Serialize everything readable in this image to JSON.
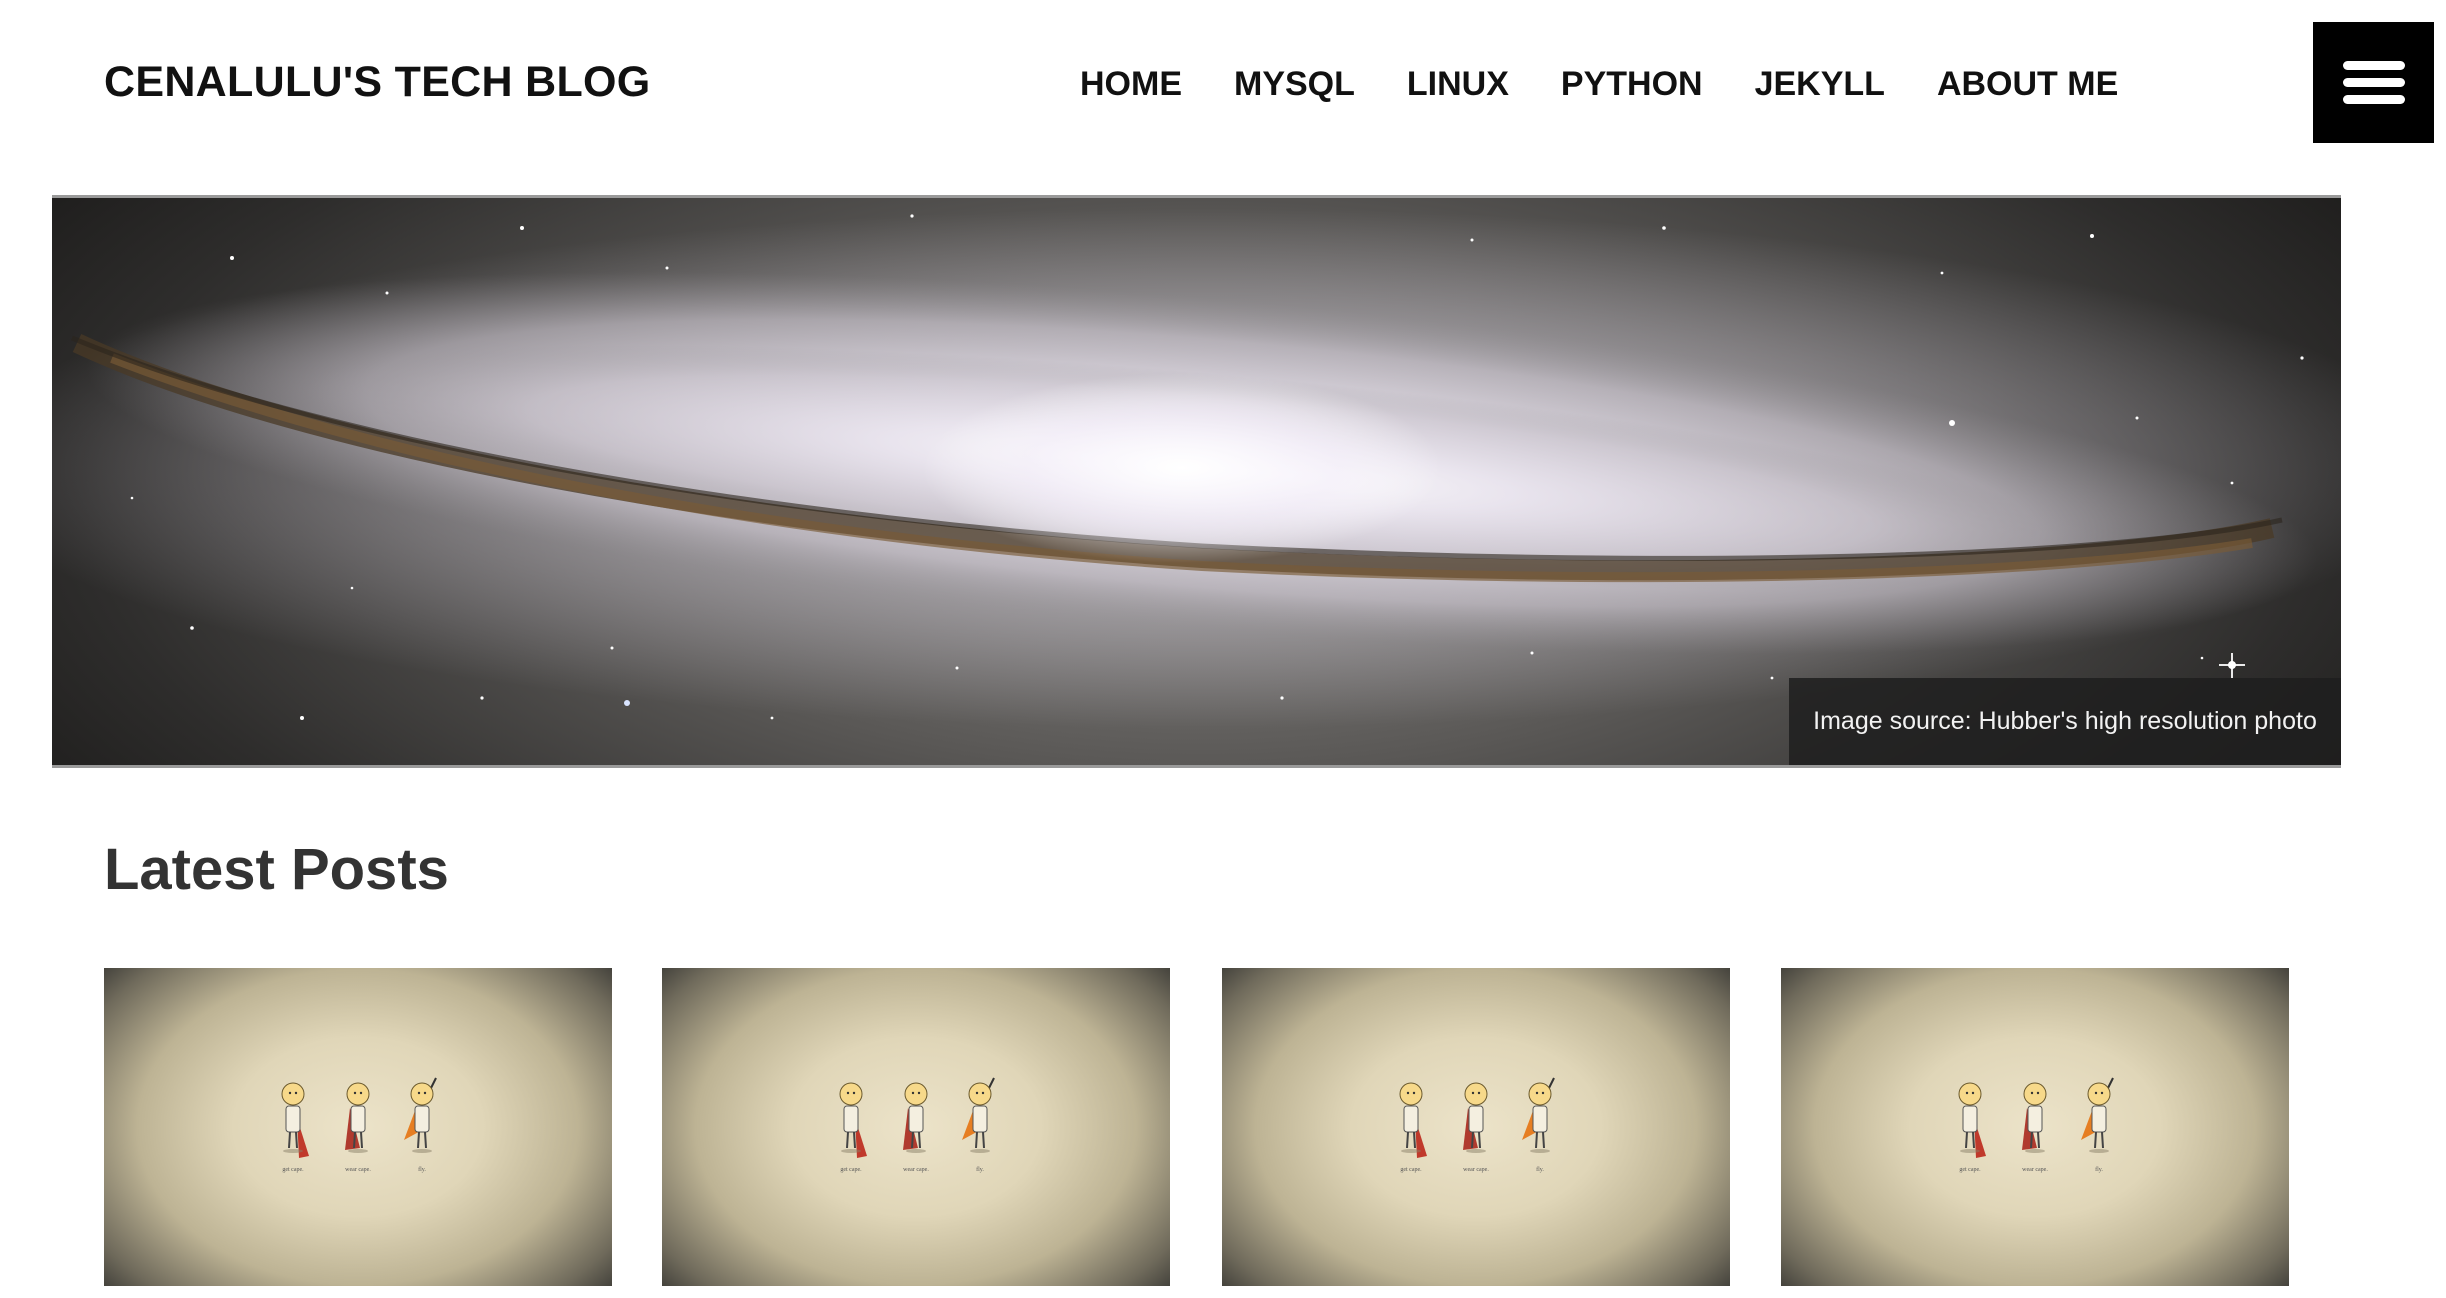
{
  "site": {
    "title": "CENALULU'S TECH BLOG"
  },
  "nav": {
    "items": [
      {
        "label": "HOME"
      },
      {
        "label": "MYSQL"
      },
      {
        "label": "LINUX"
      },
      {
        "label": "PYTHON"
      },
      {
        "label": "JEKYLL"
      },
      {
        "label": "ABOUT ME"
      }
    ],
    "menu_icon": "hamburger-menu-icon"
  },
  "hero": {
    "image": "galaxy-photo",
    "caption": "Image source: Hubber's high resolution photo"
  },
  "latest_posts": {
    "heading": "Latest Posts",
    "cards": [
      {
        "image": "get-cape-wear-cape-fly-illustration",
        "captions": [
          "get cape.",
          "wear cape.",
          "fly."
        ]
      },
      {
        "image": "get-cape-wear-cape-fly-illustration",
        "captions": [
          "get cape.",
          "wear cape.",
          "fly."
        ]
      },
      {
        "image": "get-cape-wear-cape-fly-illustration",
        "captions": [
          "get cape.",
          "wear cape.",
          "fly."
        ]
      },
      {
        "image": "get-cape-wear-cape-fly-illustration",
        "captions": [
          "get cape.",
          "wear cape.",
          "fly."
        ]
      }
    ]
  },
  "colors": {
    "text": "#111111",
    "heading": "#333333",
    "menu_button_bg": "#000000",
    "caption_bg": "#1e1e1e"
  }
}
